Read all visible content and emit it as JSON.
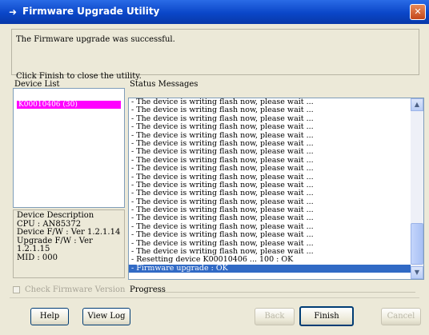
{
  "window": {
    "title": "Firmware Upgrade Utility",
    "close_glyph": "✕",
    "title_icon": "arrow-icon"
  },
  "message": "The Firmware upgrade was successful.",
  "hint": "Click Finish to close the utility.",
  "device_list": {
    "label": "Device List",
    "items": [
      "K00010406 (30)"
    ]
  },
  "device_description": {
    "lines": [
      "Device Description",
      "CPU  : AN85372",
      "Device F/W : Ver 1.2.1.14",
      "Upgrade F/W : Ver",
      "1.2.1.15",
      "MID : 000"
    ]
  },
  "status": {
    "label": "Status Messages",
    "lines": [
      "- The device is writing flash now, please wait ...",
      "- The device is writing flash now, please wait ...",
      "- The device is writing flash now, please wait ...",
      "- The device is writing flash now, please wait ...",
      "- The device is writing flash now, please wait ...",
      "- The device is writing flash now, please wait ...",
      "- The device is writing flash now, please wait ...",
      "- The device is writing flash now, please wait ...",
      "- The device is writing flash now, please wait ...",
      "- The device is writing flash now, please wait ...",
      "- The device is writing flash now, please wait ...",
      "- The device is writing flash now, please wait ...",
      "- The device is writing flash now, please wait ...",
      "- The device is writing flash now, please wait ...",
      "- The device is writing flash now, please wait ...",
      "- The device is writing flash now, please wait ...",
      "- The device is writing flash now, please wait ...",
      "- The device is writing flash now, please wait ...",
      "- The device is writing flash now, please wait ...",
      "- Resetting device K00010406 ... 100 : OK",
      "- Firmware upgrade : OK"
    ],
    "selected_index": 20,
    "scroll_up_glyph": "▲",
    "scroll_down_glyph": "▼"
  },
  "check_label": "Check Firmware Version",
  "progress_label": "Progress",
  "buttons": {
    "help": "Help",
    "view_log": "View Log",
    "back": "Back",
    "finish": "Finish",
    "cancel": "Cancel"
  }
}
